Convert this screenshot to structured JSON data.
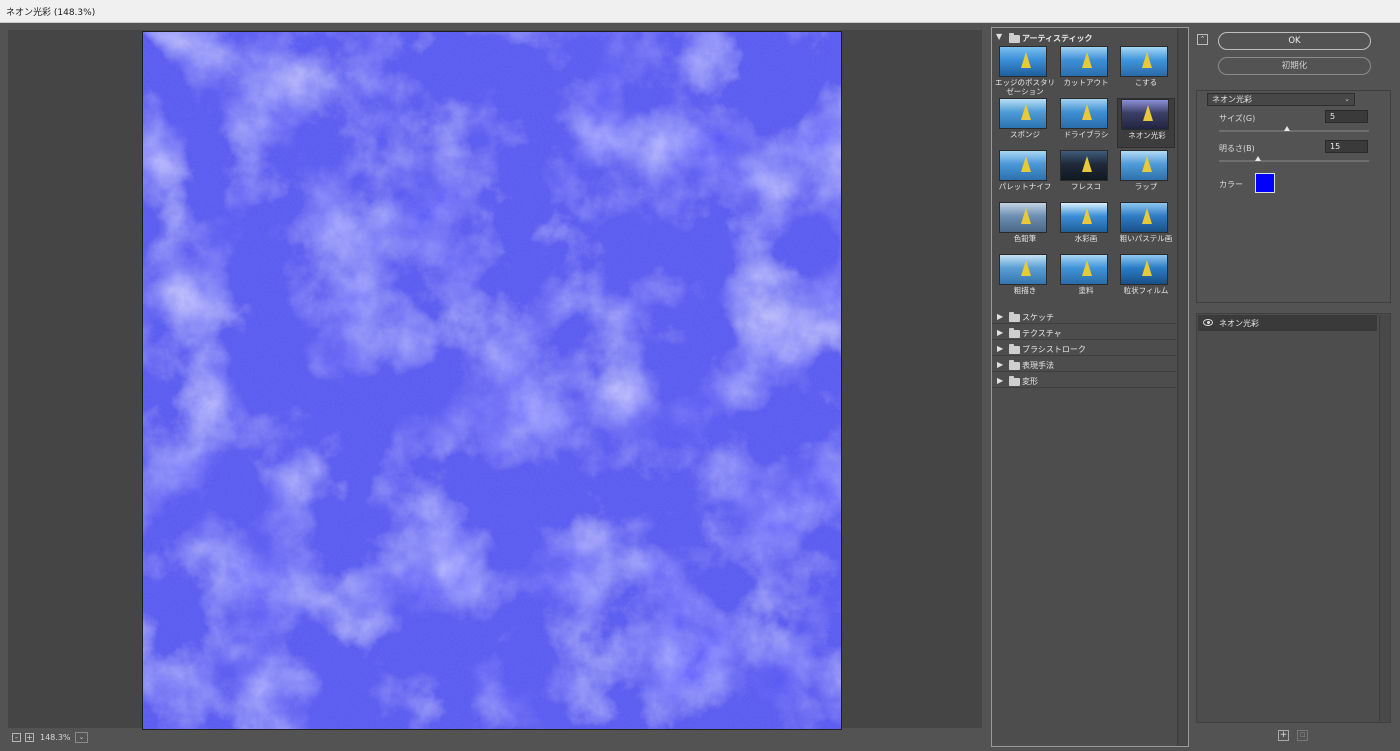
{
  "window": {
    "title": "ネオン光彩 (148.3%)"
  },
  "preview": {
    "zoom": "148.3%",
    "zoom_minus": "-",
    "zoom_plus": "+"
  },
  "gallery": {
    "open_category": "アーティスティック",
    "thumbnails": [
      {
        "label": "エッジのポスタリゼーション"
      },
      {
        "label": "カットアウト"
      },
      {
        "label": "こする"
      },
      {
        "label": "スポンジ"
      },
      {
        "label": "ドライブラシ"
      },
      {
        "label": "ネオン光彩"
      },
      {
        "label": "パレットナイフ"
      },
      {
        "label": "フレスコ"
      },
      {
        "label": "ラップ"
      },
      {
        "label": "色鉛筆"
      },
      {
        "label": "水彩画"
      },
      {
        "label": "粗いパステル画"
      },
      {
        "label": "粗描き"
      },
      {
        "label": "塗料"
      },
      {
        "label": "粒状フィルム"
      }
    ],
    "selected_index": 5,
    "categories": [
      {
        "label": "スケッチ"
      },
      {
        "label": "テクスチャ"
      },
      {
        "label": "ブラシストローク"
      },
      {
        "label": "表現手法"
      },
      {
        "label": "変形"
      }
    ]
  },
  "settings": {
    "ok_label": "OK",
    "reset_label": "初期化",
    "filter_select": "ネオン光彩",
    "params": {
      "size": {
        "label": "サイズ(G)",
        "value": "5",
        "fraction": 0.45
      },
      "brightness": {
        "label": "明るさ(B)",
        "value": "15",
        "fraction": 0.26
      },
      "color": {
        "label": "カラー",
        "hex": "#0000ff"
      }
    }
  },
  "layers": {
    "items": [
      {
        "name": "ネオン光彩",
        "visible": true
      }
    ]
  },
  "colors": {
    "preview_base": "#6a6cf4",
    "accent_selected_color": "#0000ff"
  }
}
